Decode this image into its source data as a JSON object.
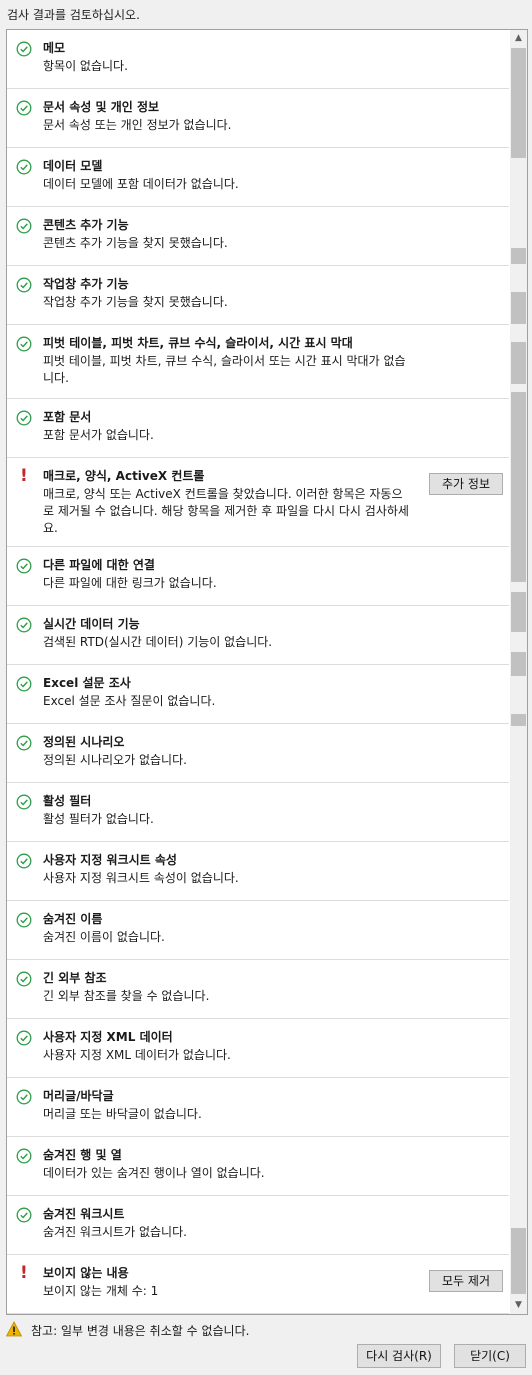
{
  "header": {
    "text": "검사 결과를 검토하십시오."
  },
  "items": [
    {
      "status": "ok",
      "title": "메모",
      "desc": "항목이 없습니다."
    },
    {
      "status": "ok",
      "title": "문서 속성 및 개인 정보",
      "desc": "문서 속성 또는 개인 정보가 없습니다."
    },
    {
      "status": "ok",
      "title": "데이터 모델",
      "desc": "데이터 모델에 포함 데이터가 없습니다."
    },
    {
      "status": "ok",
      "title": "콘텐츠 추가 기능",
      "desc": "콘텐츠 추가 기능을 찾지 못했습니다."
    },
    {
      "status": "ok",
      "title": "작업창 추가 기능",
      "desc": "작업창 추가 기능을 찾지 못했습니다."
    },
    {
      "status": "ok",
      "title": "피벗 테이블, 피벗 차트, 큐브 수식, 슬라이서, 시간 표시 막대",
      "desc": "피벗 테이블, 피벗 차트, 큐브 수식, 슬라이서 또는 시간 표시 막대가 없습니다."
    },
    {
      "status": "ok",
      "title": "포함 문서",
      "desc": "포함 문서가 없습니다."
    },
    {
      "status": "warn",
      "title": "매크로, 양식, ActiveX 컨트롤",
      "desc": "매크로, 양식 또는 ActiveX 컨트롤을 찾았습니다. 이러한 항목은 자동으로 제거될 수 없습니다. 해당 항목을 제거한 후 파일을 다시 다시 검사하세요.",
      "button": "추가 정보"
    },
    {
      "status": "ok",
      "title": "다른 파일에 대한 연결",
      "desc": "다른 파일에 대한 링크가 없습니다."
    },
    {
      "status": "ok",
      "title": "실시간 데이터 기능",
      "desc": "검색된 RTD(실시간 데이터) 기능이 없습니다."
    },
    {
      "status": "ok",
      "title": "Excel 설문 조사",
      "desc": "Excel 설문 조사 질문이 없습니다."
    },
    {
      "status": "ok",
      "title": "정의된 시나리오",
      "desc": "정의된 시나리오가 없습니다."
    },
    {
      "status": "ok",
      "title": "활성 필터",
      "desc": "활성 필터가 없습니다."
    },
    {
      "status": "ok",
      "title": "사용자 지정 워크시트 속성",
      "desc": "사용자 지정 워크시트 속성이 없습니다."
    },
    {
      "status": "ok",
      "title": "숨겨진 이름",
      "desc": "숨겨진 이름이 없습니다."
    },
    {
      "status": "ok",
      "title": "긴 외부 참조",
      "desc": "긴 외부 참조를 찾을 수 없습니다."
    },
    {
      "status": "ok",
      "title": "사용자 지정 XML 데이터",
      "desc": "사용자 지정 XML 데이터가 없습니다."
    },
    {
      "status": "ok",
      "title": "머리글/바닥글",
      "desc": "머리글 또는 바닥글이 없습니다."
    },
    {
      "status": "ok",
      "title": "숨겨진 행 및 열",
      "desc": "데이터가 있는 숨겨진 행이나 열이 없습니다."
    },
    {
      "status": "ok",
      "title": "숨겨진 워크시트",
      "desc": "숨겨진 워크시트가 없습니다."
    },
    {
      "status": "warn",
      "title": "보이지 않는 내용",
      "desc": "보이지 않는 개체 수: 1",
      "button": "모두 제거"
    }
  ],
  "footer": {
    "note": "참고: 일부 변경 내용은 취소할 수 없습니다.",
    "reinspect_label": "다시 검사(R)",
    "close_label": "닫기(C)"
  },
  "colors": {
    "ok": "#2e9e47",
    "warn": "#c4262e",
    "warning_triangle": "#f0b400"
  },
  "icons": {
    "ok": "check-circle-icon",
    "warn": "exclamation-icon",
    "note": "warning-triangle-icon"
  }
}
